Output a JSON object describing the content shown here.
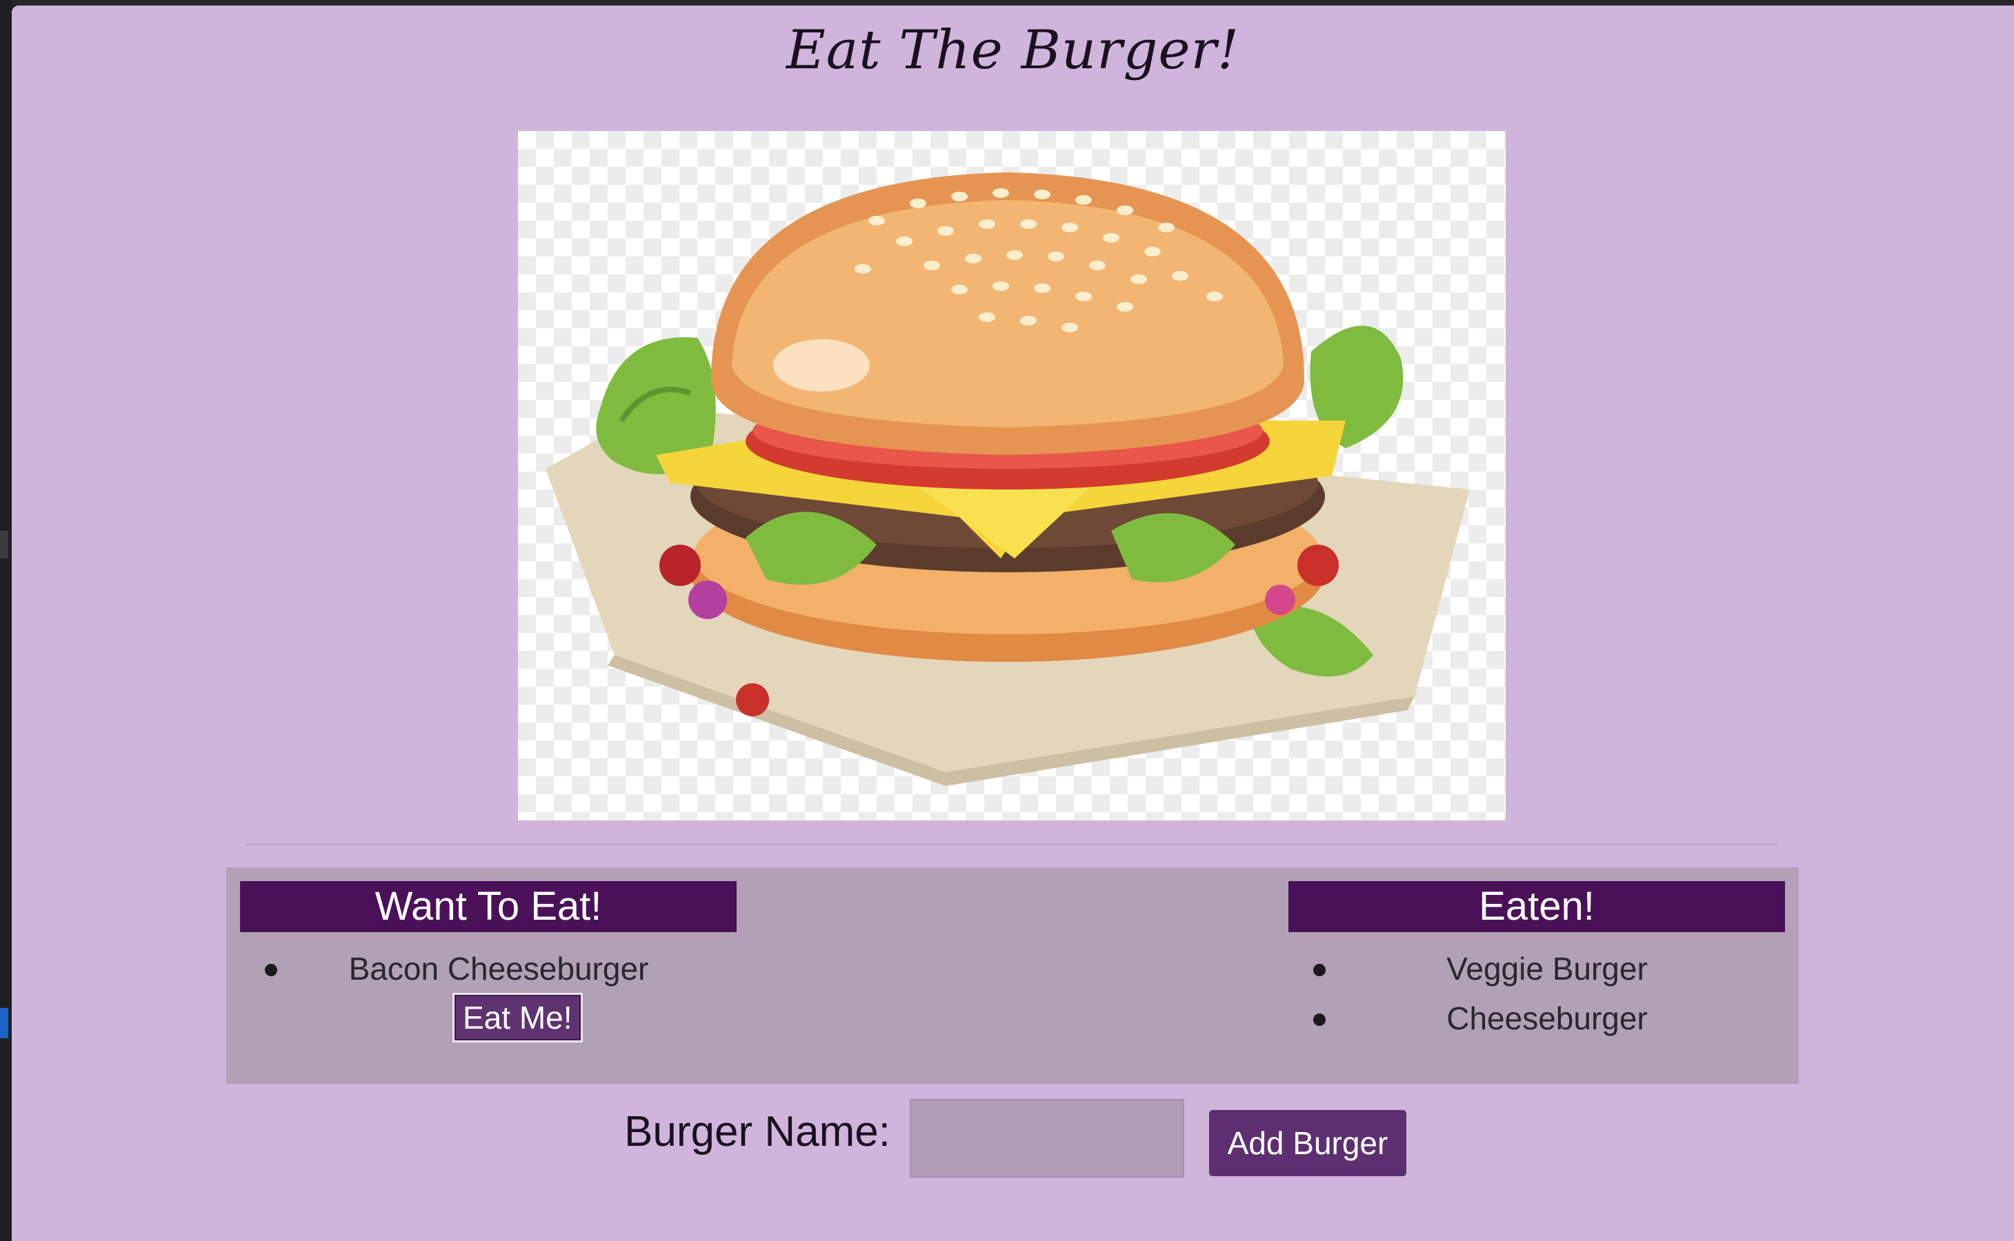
{
  "page": {
    "title": "Eat The Burger!"
  },
  "hero": {
    "image": "burger-illustration"
  },
  "lists": {
    "want": {
      "header": "Want To Eat!",
      "items": [
        {
          "name": "Bacon Cheeseburger",
          "action_label": "Eat Me!"
        }
      ]
    },
    "eaten": {
      "header": "Eaten!",
      "items": [
        {
          "name": "Veggie Burger"
        },
        {
          "name": "Cheeseburger"
        }
      ]
    }
  },
  "form": {
    "label": "Burger Name:",
    "input_value": "",
    "submit_label": "Add Burger"
  },
  "colors": {
    "page_background": "#cfb5dc",
    "panel_background": "#b2a0b6",
    "header_background": "#4a1158",
    "button_background": "#5d2f71"
  }
}
